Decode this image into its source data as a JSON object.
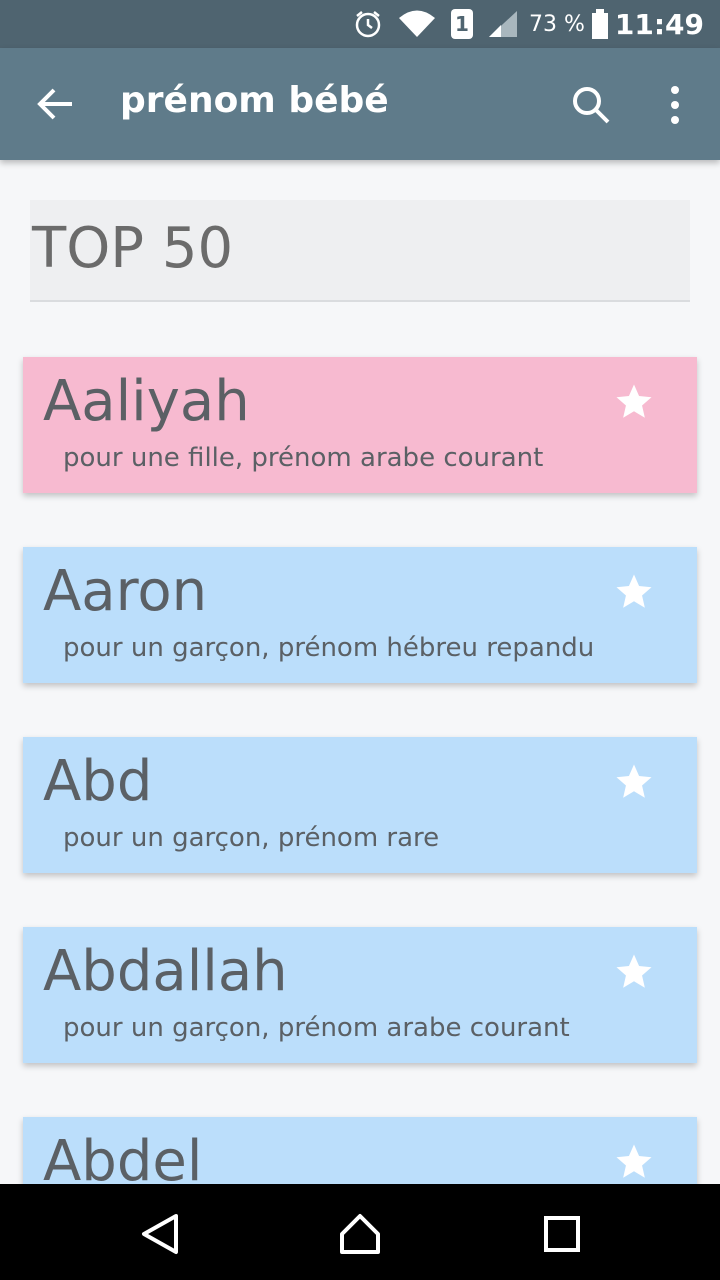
{
  "status_bar": {
    "battery_percent": "73 %",
    "time": "11:49",
    "sim_slot": "1"
  },
  "app_bar": {
    "title": "prénom bébé"
  },
  "section": {
    "title": "TOP 50"
  },
  "names": [
    {
      "name": "Aaliyah",
      "description": "pour une fille, prénom arabe courant",
      "gender": "girl"
    },
    {
      "name": "Aaron",
      "description": "pour un garçon, prénom hébreu repandu",
      "gender": "boy"
    },
    {
      "name": "Abd",
      "description": "pour un garçon, prénom rare",
      "gender": "boy"
    },
    {
      "name": "Abdallah",
      "description": "pour un garçon, prénom arabe courant",
      "gender": "boy"
    },
    {
      "name": "Abdel",
      "description": "",
      "gender": "boy"
    }
  ],
  "colors": {
    "girl_card": "#f7bad0",
    "boy_card": "#bbdefb",
    "app_bar": "#5f7b8a",
    "status_bar": "#4f6470"
  },
  "icons": {
    "status": [
      "alarm-icon",
      "wifi-icon",
      "sim-icon",
      "signal-icon",
      "battery-icon"
    ],
    "app_bar": [
      "back-arrow-icon",
      "search-icon",
      "more-vert-icon"
    ],
    "card": "star-icon",
    "nav": [
      "back-triangle-icon",
      "home-icon",
      "recents-icon"
    ]
  }
}
